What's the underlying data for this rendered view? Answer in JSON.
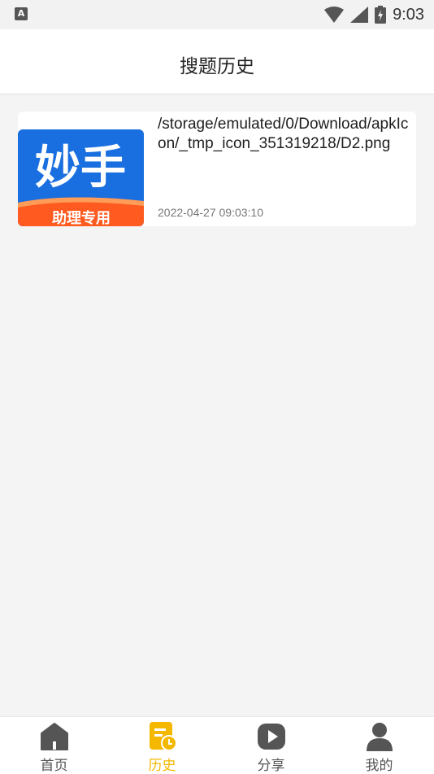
{
  "status_bar": {
    "left_icon_letter": "A",
    "time": "9:03"
  },
  "header": {
    "title": "搜题历史"
  },
  "history": [
    {
      "thumbnail": {
        "top_text": "妙手",
        "banner_text": "助理专用",
        "colors": {
          "top": "#1a6fe0",
          "banner": "#ff5a1f"
        }
      },
      "path": "/storage/emulated/0/Download/apkIcon/_tmp_icon_351319218/D2.png",
      "timestamp": "2022-04-27 09:03:10"
    }
  ],
  "bottom_nav": {
    "accent_color": "#f5b800",
    "items": [
      {
        "label": "首页",
        "icon": "home-icon",
        "active": false
      },
      {
        "label": "历史",
        "icon": "history-icon",
        "active": true
      },
      {
        "label": "分享",
        "icon": "play-icon",
        "active": false
      },
      {
        "label": "我的",
        "icon": "user-icon",
        "active": false
      }
    ]
  }
}
